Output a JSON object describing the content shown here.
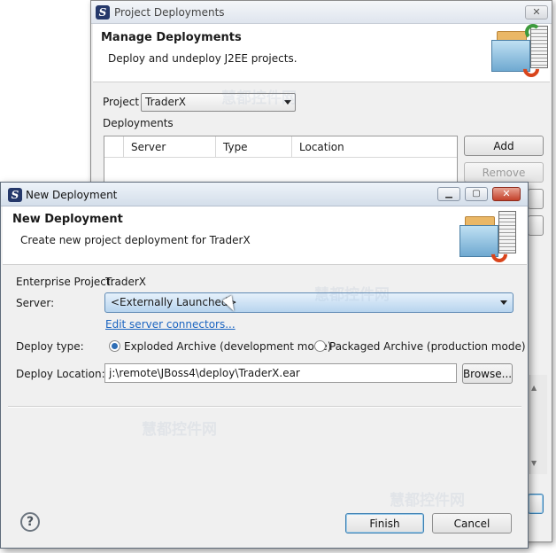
{
  "background_dialog": {
    "title": "Project Deployments",
    "close_glyph": "✕",
    "header_title": "Manage Deployments",
    "header_subtitle": "Deploy and undeploy J2EE projects.",
    "project_label": "Project",
    "project_value": "TraderX",
    "deployments_label": "Deployments",
    "columns": [
      "Server",
      "Type",
      "Location"
    ],
    "add_label": "Add",
    "remove_label": "Remove"
  },
  "dialog": {
    "title": "New Deployment",
    "minimize_glyph": "▁",
    "maximize_glyph": "▢",
    "close_glyph": "✕",
    "header_title": "New Deployment",
    "header_subtitle": "Create new project deployment for TraderX",
    "enterprise_label": "Enterprise Project:",
    "enterprise_value": "TraderX",
    "server_label": "Server:",
    "server_value": "<Externally Launched>",
    "edit_link": "Edit server connectors...",
    "deploy_type_label": "Deploy type:",
    "option_exploded": "Exploded Archive (development mode)",
    "option_packaged": "Packaged Archive (production mode)",
    "selected_option": "exploded",
    "deploy_location_label": "Deploy Location:",
    "deploy_location_value": "j:\\remote\\JBoss4\\deploy\\TraderX.ear",
    "browse_label": "Browse...",
    "finish_label": "Finish",
    "cancel_label": "Cancel",
    "help_glyph": "?"
  },
  "watermark": "慧都控件网",
  "colors": {
    "link": "#1a64c1",
    "combo_highlight": "#b7d4ee",
    "close_red": "#c3412a"
  }
}
